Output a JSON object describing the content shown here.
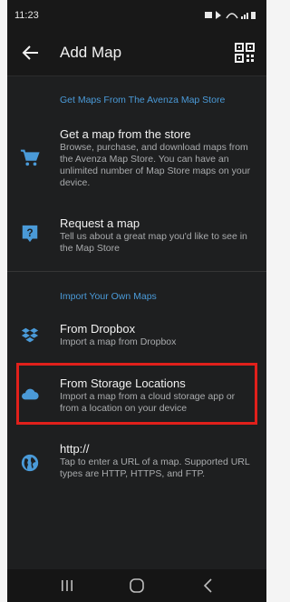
{
  "status_bar": {
    "time": "11:23"
  },
  "app_bar": {
    "title": "Add Map"
  },
  "sections": {
    "store_header": "Get Maps From The Avenza Map Store",
    "own_header": "Import Your Own Maps"
  },
  "items": [
    {
      "title": "Get a map from the store",
      "description": "Browse, purchase, and download maps from the Avenza Map Store. You can have an unlimited number of Map Store maps on your device.",
      "icon": "cart-icon"
    },
    {
      "title": "Request a map",
      "description": "Tell us about a great map you'd like to see in the Map Store",
      "icon": "question-icon"
    },
    {
      "title": "From Dropbox",
      "description": "Import a map from Dropbox",
      "icon": "dropbox-icon"
    },
    {
      "title": "From Storage Locations",
      "description": "Import a map from a cloud storage app or from a location on your device",
      "icon": "cloud-icon"
    },
    {
      "title": "http://",
      "description": "Tap to enter a URL of a map. Supported URL types are HTTP, HTTPS, and FTP.",
      "icon": "globe-icon"
    }
  ],
  "colors": {
    "accent": "#4a9ad8",
    "highlight": "#e0201b",
    "background": "#1e1f20"
  }
}
